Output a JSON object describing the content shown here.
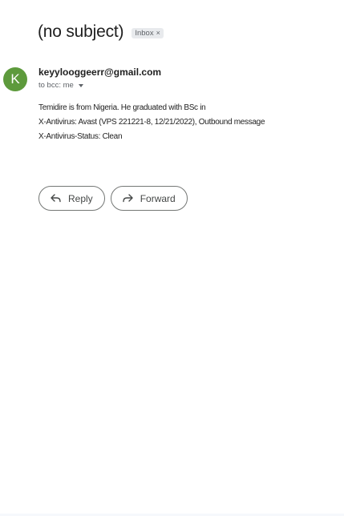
{
  "email": {
    "subject": "(no subject)",
    "label": "Inbox",
    "label_close": "×",
    "avatar_letter": "K",
    "sender": "keyylooggeerr@gmail.com",
    "recipients": "to bcc: me",
    "body_lines": [
      "Temidire is from Nigeria. He graduated with BSc in",
      "X-Antivirus: Avast (VPS 221221-8, 12/21/2022), Outbound message",
      "X-Antivirus-Status: Clean"
    ]
  },
  "actions": {
    "reply_label": "Reply",
    "forward_label": "Forward"
  },
  "colors": {
    "avatar": "#5d9a3c",
    "chip_background": "#e8eaed"
  }
}
